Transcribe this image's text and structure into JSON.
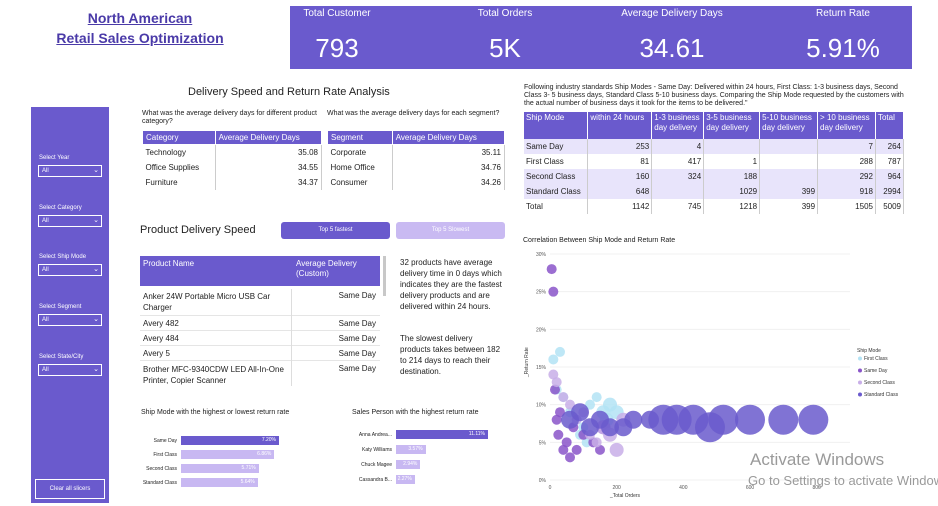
{
  "header": {
    "title_line1": "North American",
    "title_line2": "Retail Sales Optimization"
  },
  "kpis": [
    {
      "label": "Total Customer",
      "value": "793"
    },
    {
      "label": "Total Orders",
      "value": "5K"
    },
    {
      "label": "Average Delivery Days",
      "value": "34.61"
    },
    {
      "label": "Return Rate",
      "value": "5.91%"
    }
  ],
  "sidebar": {
    "slicers": [
      {
        "label": "Select Year",
        "value": "All"
      },
      {
        "label": "Select Category",
        "value": "All"
      },
      {
        "label": "Select Ship Mode",
        "value": "All"
      },
      {
        "label": "Select Segment",
        "value": "All"
      },
      {
        "label": "Select State/City",
        "value": "All"
      }
    ],
    "clear_label": "Clear all slicers"
  },
  "delivery_section": {
    "title": "Delivery Speed and Return Rate Analysis",
    "category_question": "What was the average delivery days for different product category?",
    "category_headers": [
      "Category",
      "Average Delivery Days"
    ],
    "category_rows": [
      [
        "Technology",
        "35.08"
      ],
      [
        "Office Supplies",
        "34.55"
      ],
      [
        "Furniture",
        "34.37"
      ]
    ],
    "segment_question": "What was the average delivery days for each segment?",
    "segment_headers": [
      "Segment",
      "Average Delivery Days"
    ],
    "segment_rows": [
      [
        "Corporate",
        "35.11"
      ],
      [
        "Home Office",
        "34.76"
      ],
      [
        "Consumer",
        "34.26"
      ]
    ]
  },
  "product_speed": {
    "title": "Product Delivery Speed",
    "btn_top": "Top 5 fastest",
    "btn_bottom": "Top 5 Slowest",
    "headers": [
      "Product Name",
      "Average Delivery (Custom)"
    ],
    "rows": [
      [
        "Anker 24W Portable Micro USB Car Charger",
        "Same Day"
      ],
      [
        "Avery 482",
        "Same Day"
      ],
      [
        "Avery 484",
        "Same Day"
      ],
      [
        "Avery 5",
        "Same Day"
      ],
      [
        "Brother MFC-9340CDW LED All-In-One Printer, Copier Scanner",
        "Same Day"
      ]
    ],
    "insight1": "32 products have average delivery time in 0 days which indicates they are the fastest delivery products and are delivered within 24 hours.",
    "insight2": "The slowest delivery products takes between 182 to 214 days to reach their destination."
  },
  "shipmode_bars": {
    "title": "Ship Mode with the highest or lowest return rate",
    "items": [
      {
        "label": "Same Day",
        "value_label": "7.20%",
        "value": 7.2
      },
      {
        "label": "First Class",
        "value_label": "6.86%",
        "value": 6.86
      },
      {
        "label": "Second Class",
        "value_label": "5.71%",
        "value": 5.71
      },
      {
        "label": "Standard Class",
        "value_label": "5.64%",
        "value": 5.64
      }
    ]
  },
  "salesperson_bars": {
    "title": "Sales Person with the highest return rate",
    "items": [
      {
        "label": "Anna Andrea...",
        "value_label": "11.11%",
        "value": 11.11
      },
      {
        "label": "Katy Williams",
        "value_label": "3.57%",
        "value": 3.57
      },
      {
        "label": "Chuck Magee",
        "value_label": "2.94%",
        "value": 2.94
      },
      {
        "label": "Cassandra B...",
        "value_label": "2.27%",
        "value": 2.27
      }
    ]
  },
  "ship_note": "Following industry standards Ship Modes - Same Day: Delivered within 24 hours, First Class: 1-3 business days, Second Class 3- 5 business days, Standard Class 5-10 business days. Comparing the Ship Mode requested by the customers with the actual number of business days it took for the items to be delivered.\"",
  "ship_table": {
    "headers": [
      "Ship Mode",
      "within 24 hours",
      "1-3 business day delivery",
      "3-5 business day delivery",
      "5-10 business day delivery",
      "> 10 business day delivery",
      "Total"
    ],
    "rows": [
      [
        "Same Day",
        "253",
        "4",
        "",
        "",
        "7",
        "264"
      ],
      [
        "First Class",
        "81",
        "417",
        "1",
        "",
        "288",
        "787"
      ],
      [
        "Second Class",
        "160",
        "324",
        "188",
        "",
        "292",
        "964"
      ],
      [
        "Standard Class",
        "648",
        "",
        "1029",
        "399",
        "918",
        "2994"
      ],
      [
        "Total",
        "1142",
        "745",
        "1218",
        "399",
        "1505",
        "5009"
      ]
    ]
  },
  "chart_data": {
    "type": "scatter",
    "title": "Correlation Between Ship Mode and Return Rate",
    "xlabel": "_Total Orders",
    "ylabel": "_Return Rate",
    "xlim": [
      0,
      900
    ],
    "ylim": [
      0,
      30
    ],
    "xticks": [
      "0",
      "200",
      "400",
      "600",
      "800"
    ],
    "yticks": [
      "0%",
      "5%",
      "10%",
      "15%",
      "20%",
      "25%",
      "30%"
    ],
    "legend_title": "Ship Mode",
    "legend_position": "right",
    "series": [
      {
        "name": "First Class",
        "color": "#b3e3f5",
        "points": [
          [
            10,
            16
          ],
          [
            20,
            12
          ],
          [
            40,
            11
          ],
          [
            60,
            9
          ],
          [
            80,
            8
          ],
          [
            100,
            7
          ],
          [
            120,
            10
          ],
          [
            140,
            11
          ],
          [
            160,
            9
          ],
          [
            170,
            8
          ],
          [
            180,
            10
          ],
          [
            200,
            9
          ],
          [
            90,
            6
          ],
          [
            110,
            5
          ],
          [
            30,
            17
          ]
        ]
      },
      {
        "name": "Same Day",
        "color": "#8a55c9",
        "points": [
          [
            5,
            28
          ],
          [
            10,
            25
          ],
          [
            15,
            12
          ],
          [
            20,
            8
          ],
          [
            25,
            6
          ],
          [
            30,
            9
          ],
          [
            40,
            4
          ],
          [
            50,
            5
          ],
          [
            60,
            3
          ],
          [
            70,
            7
          ],
          [
            80,
            4
          ],
          [
            100,
            6
          ],
          [
            130,
            5
          ],
          [
            160,
            7
          ],
          [
            150,
            4
          ]
        ]
      },
      {
        "name": "Second Class",
        "color": "#c8aee8",
        "points": [
          [
            10,
            14
          ],
          [
            20,
            13
          ],
          [
            40,
            11
          ],
          [
            60,
            10
          ],
          [
            80,
            8
          ],
          [
            100,
            9
          ],
          [
            120,
            6
          ],
          [
            140,
            5
          ],
          [
            160,
            7
          ],
          [
            180,
            6
          ],
          [
            200,
            4
          ],
          [
            220,
            8
          ]
        ]
      },
      {
        "name": "Standard Class",
        "color": "#6a5acd",
        "points": [
          [
            60,
            8
          ],
          [
            90,
            9
          ],
          [
            120,
            7
          ],
          [
            150,
            8
          ],
          [
            180,
            7
          ],
          [
            220,
            7
          ],
          [
            250,
            8
          ],
          [
            300,
            8
          ],
          [
            340,
            8
          ],
          [
            380,
            8
          ],
          [
            430,
            8
          ],
          [
            480,
            7
          ],
          [
            520,
            8
          ],
          [
            600,
            8
          ],
          [
            700,
            8
          ],
          [
            790,
            8
          ]
        ]
      }
    ]
  },
  "watermark": {
    "line1": "Activate Windows",
    "line2": "Go to Settings to activate Windows."
  }
}
